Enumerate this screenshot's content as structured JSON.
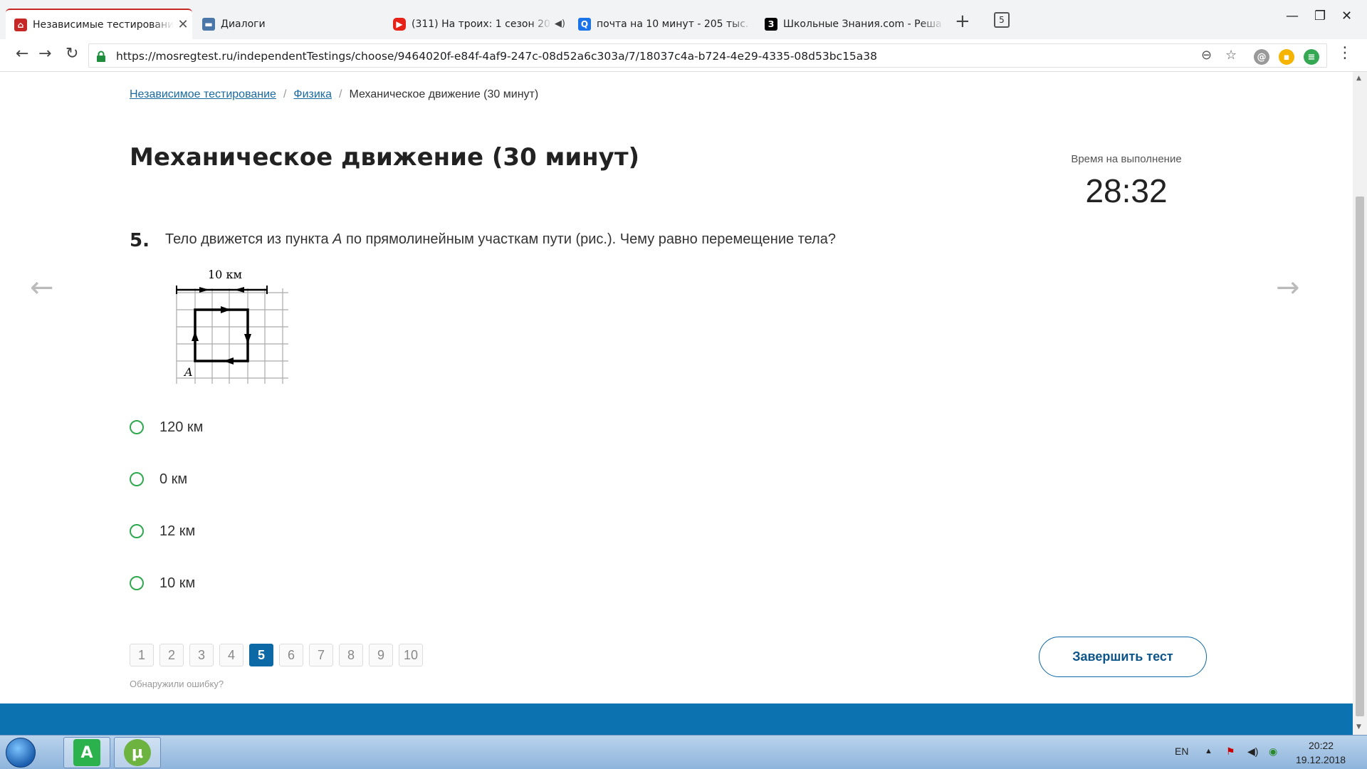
{
  "browser": {
    "tabs": [
      {
        "title": "Независимые тестировани"
      },
      {
        "title": "Диалоги"
      },
      {
        "title": "(311) На троих: 1 сезон 20 се"
      },
      {
        "title": "почта на 10 минут - 205 тыс. ре"
      },
      {
        "title": "Школьные Знания.com - Реша"
      }
    ],
    "tab_count": "5",
    "url": "https://mosregtest.ru/independentTestings/choose/9464020f-e84f-4af9-247c-08d52a6c303a/7/18037c4a-b724-4e29-4335-08d53bc15a38",
    "favicon_school": "З"
  },
  "breadcrumb": {
    "items": [
      "Независимое тестирование",
      "Физика"
    ],
    "current": "Механическое движение (30 минут)",
    "separator": "/"
  },
  "page": {
    "title": "Механическое движение (30 минут)",
    "timer_label": "Время на выполнение",
    "timer_value": "28:32"
  },
  "question": {
    "number": "5.",
    "text_before": "Тело движется из пункта ",
    "text_point": "A",
    "text_after": " по прямолинейным участкам пути (рис.). Чему равно перемещение тела?",
    "figure_scale_label": "10 км",
    "figure_point_label": "A"
  },
  "options": [
    {
      "label": "120 км"
    },
    {
      "label": "0 км"
    },
    {
      "label": "12 км"
    },
    {
      "label": "10 км"
    }
  ],
  "pager": {
    "pages": [
      "1",
      "2",
      "3",
      "4",
      "5",
      "6",
      "7",
      "8",
      "9",
      "10"
    ],
    "current": "5"
  },
  "error_link": "Обнаружили ошибку?",
  "finish_button": "Завершить тест",
  "taskbar": {
    "app1_letter": "A",
    "app2_letter": "μ",
    "lang": "EN",
    "time": "20:22",
    "date": "19.12.2018"
  },
  "colors": {
    "accent_blue": "#0d68a6",
    "radio_green": "#2fa84f",
    "footer_band": "#0d72b0",
    "active_tab_border": "#c62828"
  }
}
